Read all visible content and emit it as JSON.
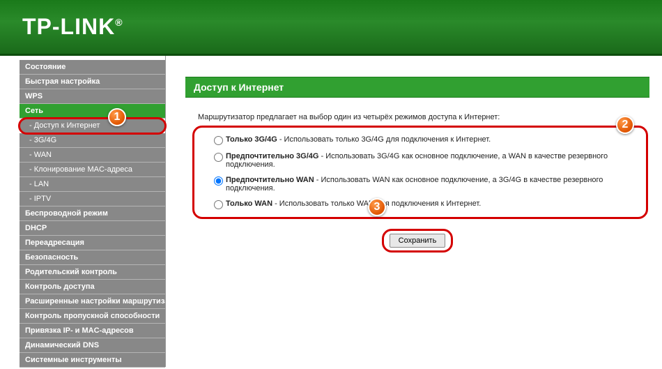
{
  "brand": "TP-LINK",
  "brand_mark": "®",
  "sidebar": {
    "items": [
      {
        "label": "Состояние",
        "bold": true
      },
      {
        "label": "Быстрая настройка",
        "bold": true
      },
      {
        "label": "WPS",
        "bold": true
      },
      {
        "label": "Сеть",
        "bold": true,
        "selected": true
      },
      {
        "label": "- Доступ к Интернет",
        "sub": true,
        "highlighted": true
      },
      {
        "label": "- 3G/4G",
        "sub": true
      },
      {
        "label": "- WAN",
        "sub": true
      },
      {
        "label": "- Клонирование MAC-адреса",
        "sub": true
      },
      {
        "label": "- LAN",
        "sub": true
      },
      {
        "label": "- IPTV",
        "sub": true
      },
      {
        "label": "Беспроводной режим",
        "bold": true
      },
      {
        "label": "DHCP",
        "bold": true
      },
      {
        "label": "Переадресация",
        "bold": true
      },
      {
        "label": "Безопасность",
        "bold": true
      },
      {
        "label": "Родительский контроль",
        "bold": true
      },
      {
        "label": "Контроль доступа",
        "bold": true
      },
      {
        "label": "Расширенные настройки маршрутизации",
        "bold": true
      },
      {
        "label": "Контроль пропускной способности",
        "bold": true
      },
      {
        "label": "Привязка IP- и MAC-адресов",
        "bold": true
      },
      {
        "label": "Динамический DNS",
        "bold": true
      },
      {
        "label": "Системные инструменты",
        "bold": true
      }
    ]
  },
  "main": {
    "title": "Доступ к Интернет",
    "intro": "Маршрутизатор предлагает на выбор один из четырёх режимов доступа к Интернет:",
    "options": [
      {
        "bold": "Только 3G/4G",
        "desc": " - Использовать только 3G/4G для подключения к Интернет.",
        "checked": false
      },
      {
        "bold": "Предпочтительно 3G/4G",
        "desc": " - Использовать 3G/4G как основное подключение, а WAN в качестве резервного подключения.",
        "checked": false
      },
      {
        "bold": "Предпочтительно WAN",
        "desc": " - Использовать WAN как основное подключение, а 3G/4G в качестве резервного подключения.",
        "checked": true
      },
      {
        "bold": "Только WAN",
        "desc": " - Использовать только WAN для подключения к Интернет.",
        "checked": false
      }
    ],
    "save": "Сохранить"
  },
  "badges": {
    "b1": "1",
    "b2": "2",
    "b3": "3"
  }
}
